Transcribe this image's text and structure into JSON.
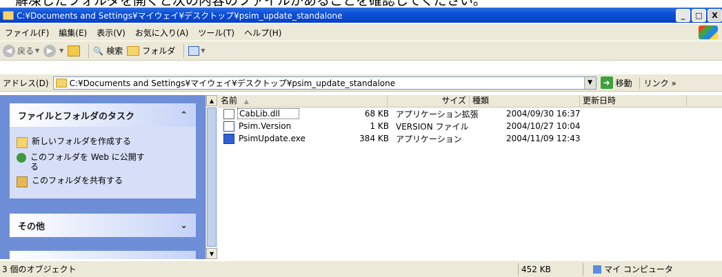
{
  "caption_text": "解凍したフォルダを開くと次の内容のファイルがあることを確認してください。",
  "window": {
    "title": "C:¥Documents and Settings¥マイウェイ¥デスクトップ¥psim_update_standalone",
    "buttons": {
      "minimize": "_",
      "maximize": "□",
      "close": "X"
    }
  },
  "menu": [
    "ファイル(F)",
    "編集(E)",
    "表示(V)",
    "お気に入り(A)",
    "ツール(T)",
    "ヘルプ(H)"
  ],
  "toolbar": {
    "back": "戻る",
    "search": "検索",
    "folders": "フォルダ"
  },
  "address": {
    "label": "アドレス(D)",
    "value": "C:¥Documents and Settings¥マイウェイ¥デスクトップ¥psim_update_standalone",
    "go": "移動",
    "links": "リンク »"
  },
  "tasks": {
    "title": "ファイルとフォルダのタスク",
    "items": [
      "新しいフォルダを作成する",
      "このフォルダを Web に公開する",
      "このフォルダを共有する"
    ]
  },
  "other": {
    "title": "その他"
  },
  "columns": {
    "name": "名前",
    "size": "サイズ",
    "type": "種類",
    "modified": "更新日時"
  },
  "files": [
    {
      "name": "CabLib.dll",
      "size": "68 KB",
      "type": "アプリケーション拡張",
      "modified": "2004/09/30 16:37",
      "icon": "dll-icon"
    },
    {
      "name": "Psim.Version",
      "size": "1 KB",
      "type": "VERSION ファイル",
      "modified": "2004/10/27 10:04",
      "icon": "version-file-icon"
    },
    {
      "name": "PsimUpdate.exe",
      "size": "384 KB",
      "type": "アプリケーション",
      "modified": "2004/11/09 12:43",
      "icon": "exe-icon"
    }
  ],
  "status": {
    "objects": "3 個のオブジェクト",
    "size": "452 KB",
    "location": "マイ コンピュータ"
  }
}
